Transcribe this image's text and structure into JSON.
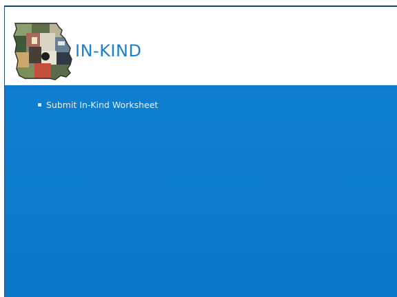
{
  "slide": {
    "title": "IN-KIND",
    "bullets": [
      {
        "text": "Submit In-Kind Worksheet"
      }
    ],
    "colors": {
      "background": "#0a7ccf",
      "header": "#ffffff",
      "title": "#1a7fcc",
      "bullet_text": "#e6f1fa"
    },
    "logo": {
      "icon": "missouri-map-collage-icon"
    }
  }
}
